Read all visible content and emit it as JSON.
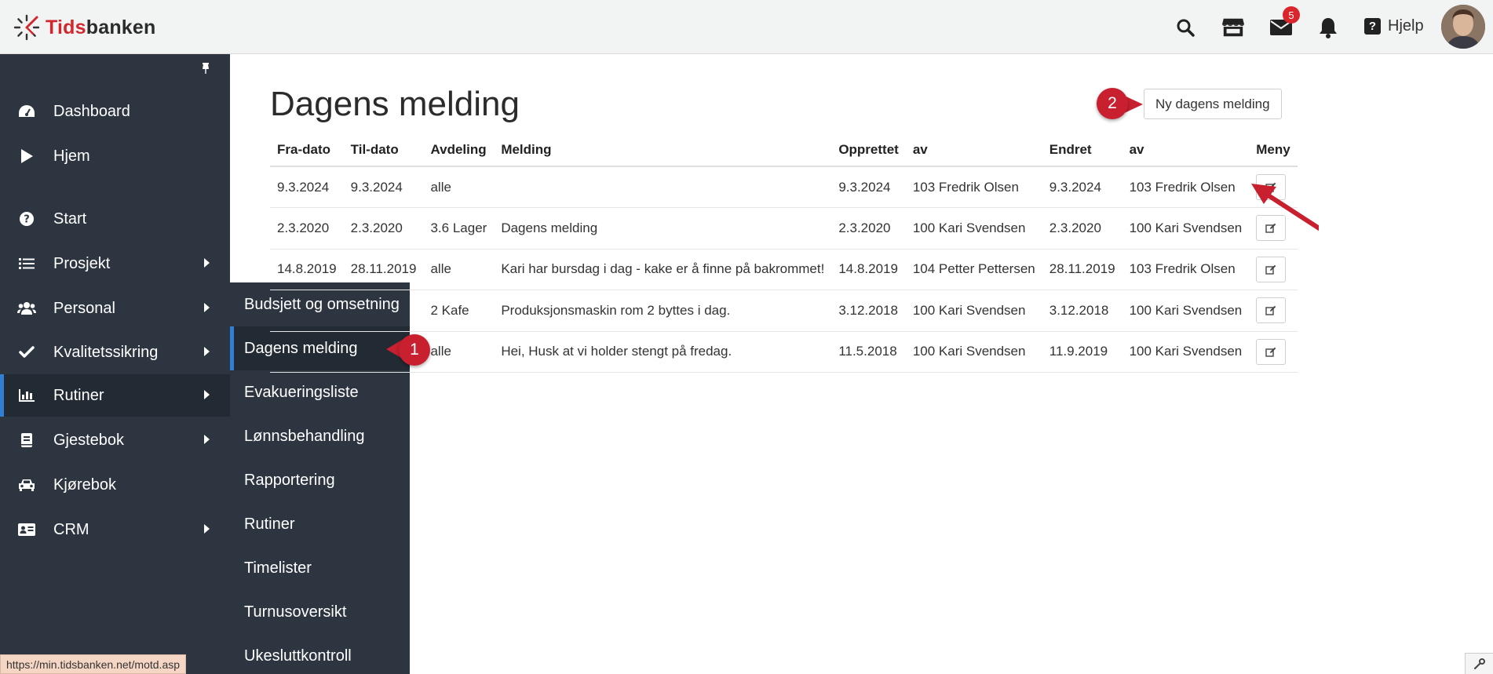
{
  "brand": {
    "part1": "Tids",
    "part2": "banken"
  },
  "header": {
    "messages_badge": "5",
    "help_label": "Hjelp",
    "help_glyph": "?"
  },
  "sidebar": {
    "items": [
      {
        "label": "Dashboard",
        "icon": "dashboard-icon"
      },
      {
        "label": "Hjem",
        "icon": "play-icon"
      },
      {
        "label": "Start",
        "icon": "question-circle-icon"
      },
      {
        "label": "Prosjekt",
        "icon": "list-icon"
      },
      {
        "label": "Personal",
        "icon": "users-icon"
      },
      {
        "label": "Kvalitetssikring",
        "icon": "check-icon"
      },
      {
        "label": "Rutiner",
        "icon": "bar-chart-icon"
      },
      {
        "label": "Gjestebok",
        "icon": "book-icon"
      },
      {
        "label": "Kjørebok",
        "icon": "car-icon"
      },
      {
        "label": "CRM",
        "icon": "id-card-icon"
      }
    ]
  },
  "submenu": {
    "items": [
      "Budsjett og omsetning",
      "Dagens melding",
      "Evakueringsliste",
      "Lønnsbehandling",
      "Rapportering",
      "Rutiner",
      "Timelister",
      "Turnusoversikt",
      "Ukesluttkontroll"
    ]
  },
  "main": {
    "title": "Dagens melding",
    "new_button": "Ny dagens melding",
    "columns": [
      "Fra-dato",
      "Til-dato",
      "Avdeling",
      "Melding",
      "Opprettet",
      "av",
      "Endret",
      "av",
      "Meny"
    ],
    "rows": [
      {
        "fra": "9.3.2024",
        "til": "9.3.2024",
        "avdeling": "alle",
        "melding": "",
        "opprettet": "9.3.2024",
        "av1": "103 Fredrik Olsen",
        "endret": "9.3.2024",
        "av2": "103 Fredrik Olsen"
      },
      {
        "fra": "2.3.2020",
        "til": "2.3.2020",
        "avdeling": "3.6 Lager",
        "melding": "Dagens melding",
        "opprettet": "2.3.2020",
        "av1": "100 Kari Svendsen",
        "endret": "2.3.2020",
        "av2": "100 Kari Svendsen"
      },
      {
        "fra": "14.8.2019",
        "til": "28.11.2019",
        "avdeling": "alle",
        "melding": "Kari har bursdag i dag - kake er å finne på bakrommet!",
        "opprettet": "14.8.2019",
        "av1": "104 Petter Pettersen",
        "endret": "28.11.2019",
        "av2": "103 Fredrik Olsen"
      },
      {
        "fra": "",
        "til": "",
        "avdeling": "2 Kafe",
        "melding": "Produksjonsmaskin rom 2 byttes i dag.",
        "opprettet": "3.12.2018",
        "av1": "100 Kari Svendsen",
        "endret": "3.12.2018",
        "av2": "100 Kari Svendsen"
      },
      {
        "fra": "",
        "til": "",
        "avdeling": "alle",
        "melding": "Hei, Husk at vi holder stengt på fredag.",
        "opprettet": "11.5.2018",
        "av1": "100 Kari Svendsen",
        "endret": "11.9.2019",
        "av2": "100 Kari Svendsen"
      }
    ]
  },
  "callouts": {
    "one": "1",
    "two": "2"
  },
  "statusbar": {
    "url": "https://min.tidsbanken.net/motd.asp"
  },
  "colors": {
    "sidebar_bg": "#2d3640",
    "active_bg": "#222a33",
    "accent": "#2f7fd6",
    "brand_red": "#d0282f",
    "callout_red": "#c8202f"
  }
}
